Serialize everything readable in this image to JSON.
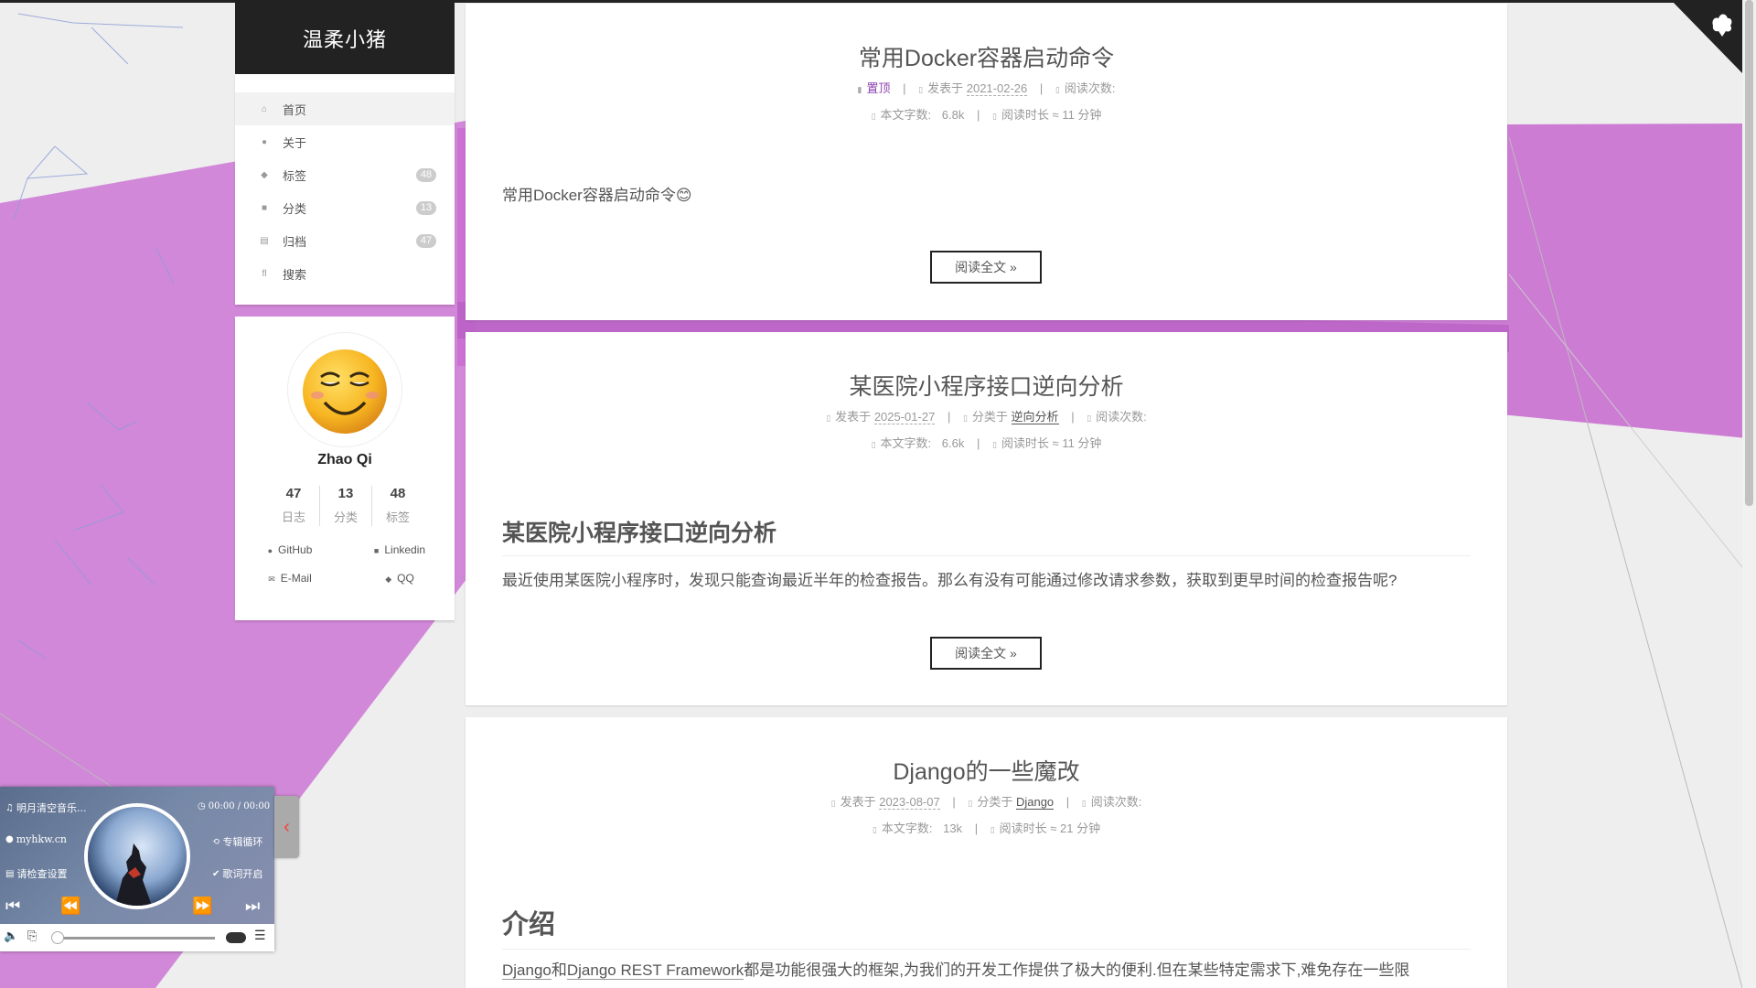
{
  "site": {
    "title": "温柔小猪"
  },
  "menu": [
    {
      "label": "首页",
      "icon": "home-icon",
      "glyph": "⌂",
      "count": ""
    },
    {
      "label": "关于",
      "icon": "user-icon",
      "glyph": "●",
      "count": ""
    },
    {
      "label": "标签",
      "icon": "tags-icon",
      "glyph": "◆",
      "count": "48"
    },
    {
      "label": "分类",
      "icon": "th-icon",
      "glyph": "■",
      "count": "13"
    },
    {
      "label": "归档",
      "icon": "archive-icon",
      "glyph": "▤",
      "count": "47"
    },
    {
      "label": "搜索",
      "icon": "search-icon",
      "glyph": "fl",
      "count": ""
    }
  ],
  "profile": {
    "name": "Zhao Qi",
    "stats": [
      {
        "num": "47",
        "label": "日志"
      },
      {
        "num": "13",
        "label": "分类"
      },
      {
        "num": "48",
        "label": "标签"
      }
    ],
    "links": [
      {
        "label": "GitHub",
        "icon": "github-icon"
      },
      {
        "label": "Linkedin",
        "icon": "linkedin-icon"
      },
      {
        "label": "E-Mail",
        "icon": "envelope-icon"
      },
      {
        "label": "QQ",
        "icon": "qq-icon"
      }
    ]
  },
  "posts": [
    {
      "title": "常用Docker容器启动命令",
      "pinned": "置顶",
      "posted_label": "发表于",
      "date": "2021-02-26",
      "views_label": "阅读次数:",
      "words_label": "本文字数:",
      "words": "6.8k",
      "time_label": "阅读时长 ≈",
      "time": "11 分钟",
      "excerpt": "常用Docker容器启动命令😊",
      "read_more": "阅读全文 »"
    },
    {
      "title": "某医院小程序接口逆向分析",
      "posted_label": "发表于",
      "date": "2025-01-27",
      "category_label": "分类于",
      "category": "逆向分析",
      "views_label": "阅读次数:",
      "words_label": "本文字数:",
      "words": "6.6k",
      "time_label": "阅读时长 ≈",
      "time": "11 分钟",
      "heading": "某医院小程序接口逆向分析",
      "excerpt": "最近使用某医院小程序时，发现只能查询最近半年的检查报告。那么有没有可能通过修改请求参数，获取到更早时间的检查报告呢?",
      "read_more": "阅读全文 »"
    },
    {
      "title": "Django的一些魔改",
      "posted_label": "发表于",
      "date": "2023-08-07",
      "category_label": "分类于",
      "category": "Django",
      "views_label": "阅读次数:",
      "words_label": "本文字数:",
      "words": "13k",
      "time_label": "阅读时长 ≈",
      "time": "21 分钟",
      "heading": "介绍",
      "excerpt_link1": "Django",
      "excerpt_and": "和",
      "excerpt_link2": "Django REST Framework",
      "excerpt_rest": "都是功能很强大的框架,为我们的开发工作提供了极大的便利.但在某些特定需求下,难免存在一些限"
    }
  ],
  "player": {
    "song": "明月清空音乐...",
    "time": "00:00 / 00:00",
    "artist": "myhkw.cn",
    "loop": "专辑循环",
    "settings": "请检查设置",
    "lyrics": "歌词开启",
    "progress": 0
  },
  "colors": {
    "accent_purple": "#8e44ad",
    "header_dark": "#222222",
    "bg_pink": "#d07ad6"
  }
}
